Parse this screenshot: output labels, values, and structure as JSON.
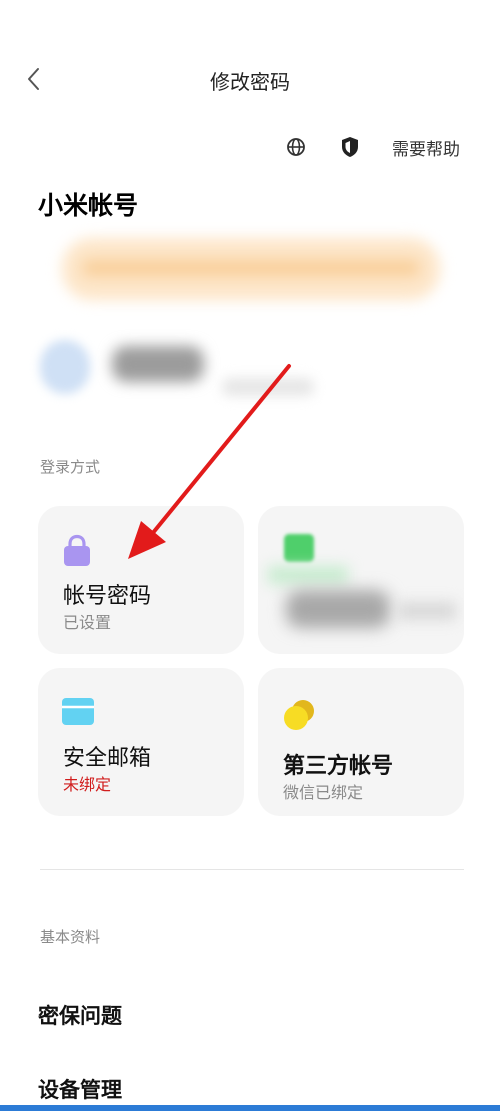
{
  "header": {
    "title": "修改密码",
    "back_icon": "chevron-left-icon"
  },
  "toolbar": {
    "globe_icon": "globe-icon",
    "shield_icon": "shield-icon",
    "help_label": "需要帮助"
  },
  "account": {
    "title": "小米帐号"
  },
  "login_section": {
    "label": "登录方式",
    "cards": [
      {
        "icon": "lock-icon",
        "title": "帐号密码",
        "status": "已设置",
        "status_color": "#8a8a8a"
      },
      {
        "icon": "phone-icon",
        "title": "",
        "status": "",
        "obscured": true
      },
      {
        "icon": "mail-icon",
        "title": "安全邮箱",
        "status": "未绑定",
        "status_color": "#d11d1d"
      },
      {
        "icon": "coins-icon",
        "title": "第三方帐号",
        "status": "微信已绑定",
        "status_color": "#8a8a8a"
      }
    ]
  },
  "basic_section": {
    "label": "基本资料",
    "items": [
      {
        "label": "密保问题"
      },
      {
        "label": "设备管理"
      }
    ]
  },
  "colors": {
    "accent_red": "#e21b1b",
    "lock_purple": "#a995f0",
    "mail_blue": "#62d2f2",
    "coin_yellow": "#f3d62a",
    "card_bg": "#f5f5f5"
  }
}
